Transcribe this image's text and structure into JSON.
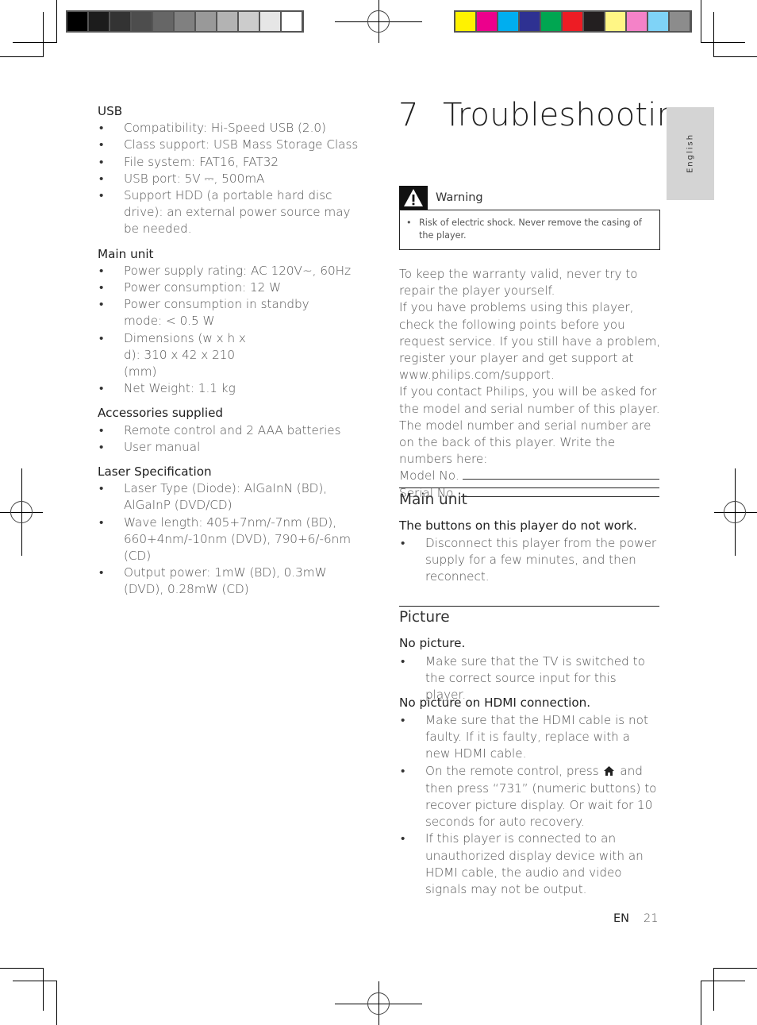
{
  "print_marks": {
    "grayscale_swatches": [
      "#000000",
      "#1c1c1c",
      "#333333",
      "#4d4d4d",
      "#666666",
      "#808080",
      "#999999",
      "#b3b3b3",
      "#cccccc",
      "#e6e6e6",
      "#ffffff"
    ],
    "color_swatches": [
      "#fff200",
      "#ec008c",
      "#00aeef",
      "#2e3192",
      "#00a651",
      "#ed1c24",
      "#231f20",
      "#fff685",
      "#f482c8",
      "#7fd3f7",
      "#8c8c8c"
    ]
  },
  "language_tab": "English",
  "specs": [
    {
      "heading": "USB",
      "items": [
        "Compatibility: Hi-Speed USB (2.0)",
        "Class support: USB Mass Storage Class",
        "File system: FAT16, FAT32",
        "USB port: 5V ⎓, 500mA",
        "Support HDD (a portable hard disc drive): an external power source may be needed."
      ]
    },
    {
      "heading": "Main unit",
      "items": [
        "Power supply rating: AC 120V~, 60Hz",
        "Power consumption: 12 W",
        "Power consumption in standby mode: < 0.5 W",
        "Dimensions (w x h x d): 310 x 42 x 210 (mm)",
        "Net Weight: 1.1 kg"
      ]
    },
    {
      "heading": "Accessories supplied",
      "items": [
        "Remote control and 2 AAA batteries",
        "User manual"
      ]
    },
    {
      "heading": "Laser Specification",
      "items": [
        "Laser Type (Diode): AlGaInN (BD), AlGaInP (DVD/CD)",
        "Wave length: 405+7nm/-7nm (BD), 660+4nm/-10nm (DVD), 790+6/-6nm (CD)",
        "Output power: 1mW (BD), 0.3mW (DVD), 0.28mW (CD)"
      ]
    }
  ],
  "chapter": {
    "number": "7",
    "title": "Troubleshooting"
  },
  "warning": {
    "label": "Warning",
    "icon": "warning-triangle-icon",
    "items": [
      "Risk of electric shock. Never remove the casing of the player."
    ]
  },
  "intro": {
    "p1": "To keep the warranty valid, never try to repair the player yourself.",
    "p2": "If you have problems using this player, check the following points before you request service. If you still have a problem, register your player and get support at www.philips.com/support.",
    "p3": "If you contact Philips, you will be asked for the model and serial number of this player. The model number and serial number are on the back of this player. Write the numbers here:",
    "model_label": "Model No.",
    "serial_label": "Serial No."
  },
  "sections": {
    "main_unit": {
      "title": "Main unit",
      "q1": "The buttons on this player do not work.",
      "q1_items": [
        "Disconnect this player from the power supply for a few minutes, and then reconnect."
      ]
    },
    "picture": {
      "title": "Picture",
      "q1": "No picture.",
      "q1_items": [
        "Make sure that the TV is switched to the correct source input for this player."
      ],
      "q2": "No picture on HDMI connection.",
      "q2_items": [
        "Make sure that the HDMI cable is not faulty. If it is faulty, replace with a new HDMI cable.",
        "On the remote control, press",
        "and then press “731” (numeric buttons) to recover picture display. Or wait for 10 seconds for auto recovery.",
        "If this player is connected to an unauthorized display device with an HDMI cable, the audio and video signals may not be output."
      ],
      "home_icon": "home-icon"
    }
  },
  "footer": {
    "lang": "EN",
    "page": "21"
  },
  "bullet": "•"
}
